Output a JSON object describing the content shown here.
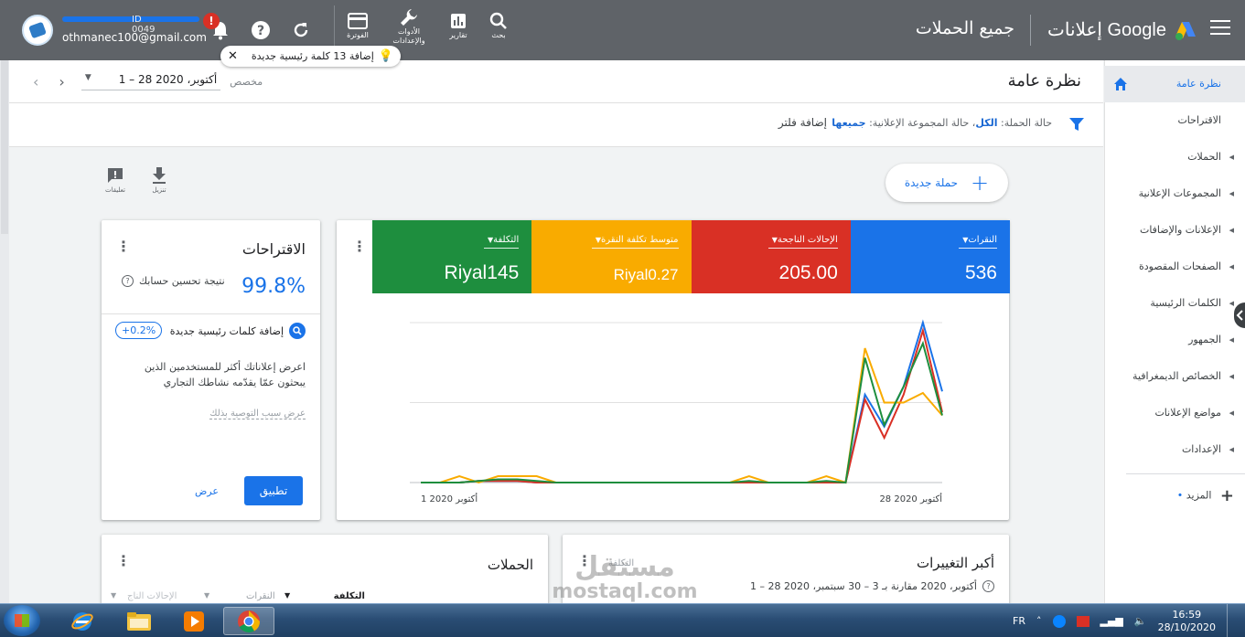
{
  "topbar": {
    "brand": "إعلانات Google",
    "page_title": "جميع الحملات",
    "actions": [
      {
        "label": "بحث",
        "icon": "search-icon"
      },
      {
        "label": "تقارير",
        "icon": "reports-icon"
      },
      {
        "label": "الأدوات والإعدادات",
        "icon": "wrench-icon"
      },
      {
        "label": "الفوترة",
        "icon": "billing-card-icon"
      }
    ],
    "account_id_fragment": "ID 0049",
    "account_email": "othmanec100@gmail.com",
    "alert_symbol": "!",
    "toast_text": "إضافة 13 كلمة رئيسية جديدة"
  },
  "nav": {
    "items": [
      {
        "label": "نظرة عامة",
        "active": true,
        "caret": false,
        "home": true
      },
      {
        "label": "الاقتراحات",
        "active": false,
        "caret": false
      },
      {
        "label": "الحملات",
        "active": false,
        "caret": true
      },
      {
        "label": "المجموعات الإعلانية",
        "active": false,
        "caret": true
      },
      {
        "label": "الإعلانات والإضافات",
        "active": false,
        "caret": true
      },
      {
        "label": "الصفحات المقصودة",
        "active": false,
        "caret": true
      },
      {
        "label": "الكلمات الرئيسية",
        "active": false,
        "caret": true
      },
      {
        "label": "الجمهور",
        "active": false,
        "caret": true
      },
      {
        "label": "الخصائص الديمغرافية",
        "active": false,
        "caret": true
      },
      {
        "label": "مواضع الإعلانات",
        "active": false,
        "caret": true
      },
      {
        "label": "الإعدادات",
        "active": false,
        "caret": true
      }
    ],
    "more_label": "المزيد"
  },
  "header": {
    "title": "نظرة عامة",
    "date_range": "1 – 28 أكتوبر، 2020",
    "date_label": "مخصص"
  },
  "filters": {
    "campaign_status_label": "حالة الحملة:",
    "campaign_status_value": "الكل",
    "adgroup_status_label": "حالة المجموعة الإعلانية:",
    "adgroup_status_value": "جميعها",
    "add_filter": "إضافة فلتر"
  },
  "toolbar": {
    "new_campaign": "حملة جديدة",
    "download": "تنزيل",
    "comments": "تعليقات"
  },
  "metrics": [
    {
      "label": "النقرات",
      "value": "536",
      "color": "#1a73e8"
    },
    {
      "label": "الإحالات الناجحة",
      "value": "205.00",
      "color": "#d93025"
    },
    {
      "label": "متوسط تكلفة النقرة",
      "value": "Riyal0.27",
      "color": "#f9ab00"
    },
    {
      "label": "التكلفة",
      "value": "Riyal145",
      "color": "#1e8e3e"
    }
  ],
  "chart_data": {
    "type": "line",
    "x_start_label": "1 أكتوبر 2020",
    "x_end_label": "28 أكتوبر 2020",
    "x": [
      1,
      2,
      3,
      4,
      5,
      6,
      7,
      8,
      9,
      10,
      11,
      12,
      13,
      14,
      15,
      16,
      17,
      18,
      19,
      20,
      21,
      22,
      23,
      24,
      25,
      26,
      27,
      28
    ],
    "ylim": [
      0,
      100
    ],
    "series": [
      {
        "metric": "النقرات",
        "color": "#1a73e8",
        "values": [
          0,
          0,
          0,
          1,
          1,
          1,
          0,
          0,
          0,
          0,
          0,
          0,
          0,
          0,
          0,
          0,
          0,
          0,
          0,
          0,
          0,
          0,
          0,
          55,
          35,
          60,
          100,
          57
        ]
      },
      {
        "metric": "الإحالات الناجحة",
        "color": "#d93025",
        "values": [
          0,
          0,
          0,
          1,
          1,
          1,
          0,
          0,
          0,
          0,
          0,
          0,
          0,
          0,
          0,
          0,
          0,
          0,
          0,
          0,
          0,
          0,
          0,
          52,
          28,
          55,
          95,
          44
        ]
      },
      {
        "metric": "متوسط تكلفة النقرة",
        "color": "#f9ab00",
        "values": [
          0,
          0,
          4,
          0,
          4,
          4,
          4,
          0,
          0,
          0,
          0,
          0,
          0,
          0,
          0,
          0,
          0,
          4,
          0,
          0,
          0,
          4,
          0,
          84,
          50,
          50,
          56,
          42
        ]
      },
      {
        "metric": "التكلفة",
        "color": "#1e8e3e",
        "values": [
          0,
          0,
          0,
          1,
          2,
          2,
          1,
          0,
          0,
          0,
          0,
          0,
          0,
          0,
          0,
          0,
          0,
          1,
          0,
          0,
          0,
          1,
          0,
          78,
          36,
          60,
          87,
          42
        ]
      }
    ]
  },
  "suggestions": {
    "title": "الاقتراحات",
    "score": "99.8%",
    "score_label": "نتيجة تحسين حسابك",
    "keyword_title": "إضافة كلمات رئيسية جديدة",
    "keyword_badge": "+0.2%",
    "description": "اعرض إعلاناتك أكثر للمستخدمين الذين يبحثون عمّا يقدّمه نشاطك التجاري",
    "why": "عرض سبب التوصية بذلك",
    "apply": "تطبيق",
    "view": "عرض"
  },
  "campaigns_card": {
    "title": "الحملات",
    "col_cost": "التكلفة",
    "col_clicks": "النقرات",
    "col_conv": "الإحالات الناج"
  },
  "changes_card": {
    "title": "أكبر التغييرات",
    "subtitle": "1 – 28 أكتوبر، 2020 مقارنة بـ 3 – 30 سبتمبر، 2020",
    "metric": "التكلفة"
  },
  "watermark": {
    "line1": "مستقل",
    "line2": "mostaql.com"
  },
  "taskbar": {
    "lang": "FR",
    "time": "16:59",
    "date": "28/10/2020"
  }
}
